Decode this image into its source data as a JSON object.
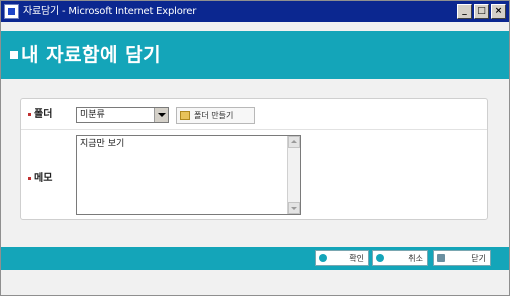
{
  "window": {
    "title": "자료담기 - Microsoft Internet Explorer",
    "buttons": {
      "minimize": "_",
      "maximize": "□",
      "close": "×"
    }
  },
  "header": {
    "title": "내 자료함에 담기"
  },
  "form": {
    "folder_label": "폴더",
    "folder_selected": "미분류",
    "folder_manage_label": "폴더 만들기",
    "memo_label": "메모",
    "memo_value": "지금만 보기"
  },
  "footer": {
    "ok_label": "확인",
    "cancel_label": "취소",
    "close_label": "닫기"
  },
  "icons": {
    "app": "ie-app-icon",
    "folder": "folder-icon",
    "ok": "ok-icon",
    "cancel": "cancel-icon",
    "close": "close-icon"
  },
  "colors": {
    "titlebar": "#0b2790",
    "accent": "#14a5b9",
    "background": "#f1f1f1"
  }
}
